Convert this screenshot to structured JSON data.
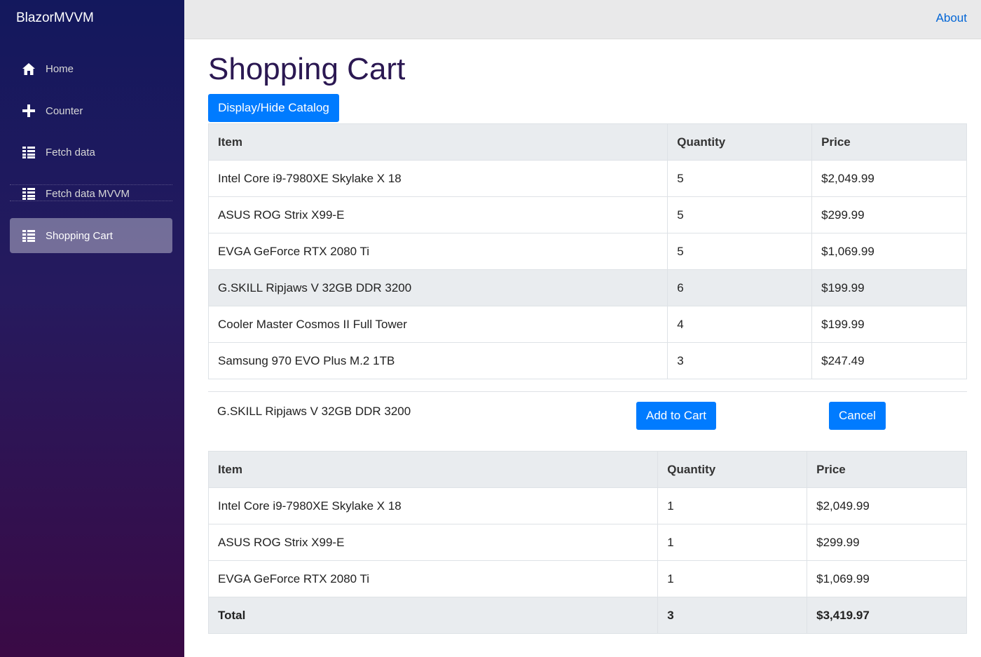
{
  "sidebar": {
    "brand": "BlazorMVVM",
    "items": [
      {
        "label": "Home",
        "icon": "home-icon"
      },
      {
        "label": "Counter",
        "icon": "plus-icon"
      },
      {
        "label": "Fetch data",
        "icon": "list-icon"
      },
      {
        "label": "Fetch data MVVM",
        "icon": "list-icon"
      },
      {
        "label": "Shopping Cart",
        "icon": "list-icon",
        "active": true
      }
    ]
  },
  "topbar": {
    "about": "About"
  },
  "main": {
    "title": "Shopping Cart",
    "toggle_button": "Display/Hide Catalog",
    "catalog": {
      "headers": [
        "Item",
        "Quantity",
        "Price"
      ],
      "rows": [
        {
          "item": "Intel Core i9-7980XE Skylake X 18",
          "quantity": "5",
          "price": "$2,049.99"
        },
        {
          "item": "ASUS ROG Strix X99-E",
          "quantity": "5",
          "price": "$299.99"
        },
        {
          "item": "EVGA GeForce RTX 2080 Ti",
          "quantity": "5",
          "price": "$1,069.99"
        },
        {
          "item": "G.SKILL Ripjaws V 32GB DDR 3200",
          "quantity": "6",
          "price": "$199.99"
        },
        {
          "item": "Cooler Master Cosmos II Full Tower",
          "quantity": "4",
          "price": "$199.99"
        },
        {
          "item": "Samsung 970 EVO Plus M.2 1TB",
          "quantity": "3",
          "price": "$247.49"
        }
      ]
    },
    "selection": {
      "item": "G.SKILL Ripjaws V 32GB DDR 3200",
      "add_button": "Add to Cart",
      "cancel_button": "Cancel"
    },
    "cart": {
      "headers": [
        "Item",
        "Quantity",
        "Price"
      ],
      "rows": [
        {
          "item": "Intel Core i9-7980XE Skylake X 18",
          "quantity": "1",
          "price": "$2,049.99"
        },
        {
          "item": "ASUS ROG Strix X99-E",
          "quantity": "1",
          "price": "$299.99"
        },
        {
          "item": "EVGA GeForce RTX 2080 Ti",
          "quantity": "1",
          "price": "$1,069.99"
        }
      ],
      "total": {
        "label": "Total",
        "quantity": "3",
        "price": "$3,419.97"
      }
    }
  },
  "colors": {
    "accent": "#007bff",
    "link": "#0366d6",
    "title": "#2b1852",
    "sidebar_top": "#13185d",
    "sidebar_bottom": "#3a0a45"
  }
}
